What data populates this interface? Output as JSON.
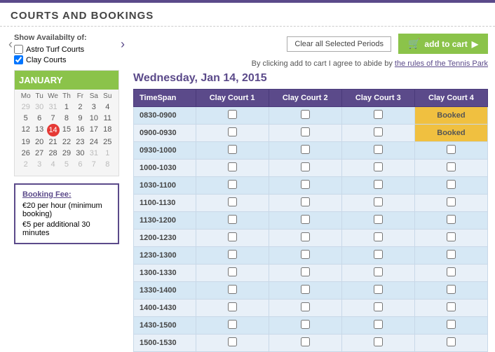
{
  "page": {
    "title": "COURTS AND BOOKINGS",
    "top_bar_color": "#5b4a8a"
  },
  "actions": {
    "clear_btn_label": "Clear all Selected Periods",
    "cart_btn_label": "add to cart",
    "agree_text": "By clicking add to cart I agree to abide by",
    "agree_link": "the rules of the Tennis Park"
  },
  "availability": {
    "label": "Show Availabilty of:",
    "options": [
      {
        "id": "astro",
        "label": "Astro Turf Courts",
        "checked": false
      },
      {
        "id": "clay",
        "label": "Clay Courts",
        "checked": true
      }
    ]
  },
  "calendar": {
    "month": "JANUARY",
    "days_header": [
      "Mo",
      "Tu",
      "We",
      "Th",
      "Fr",
      "Sa",
      "Su"
    ],
    "weeks": [
      [
        "29",
        "30",
        "31",
        "1",
        "2",
        "3",
        "4"
      ],
      [
        "5",
        "6",
        "7",
        "8",
        "9",
        "10",
        "11"
      ],
      [
        "12",
        "13",
        "14",
        "15",
        "16",
        "17",
        "18"
      ],
      [
        "19",
        "20",
        "21",
        "22",
        "23",
        "24",
        "25"
      ],
      [
        "26",
        "27",
        "28",
        "29",
        "30",
        "31",
        "1"
      ],
      [
        "2",
        "3",
        "4",
        "5",
        "6",
        "7",
        "8"
      ]
    ],
    "today_date": "14",
    "other_month_start": [
      "29",
      "30",
      "31"
    ],
    "other_month_end": [
      "1",
      "2",
      "3",
      "4",
      "1",
      "2",
      "3",
      "4",
      "5",
      "6",
      "7",
      "8"
    ]
  },
  "booking_fee": {
    "title": "Booking Fee:",
    "line1": "€20 per hour (minimum booking)",
    "line2": "€5 per additional 30 minutes"
  },
  "booking_date": "Wednesday, Jan 14, 2015",
  "table": {
    "headers": [
      "TimeSpan",
      "Clay Court 1",
      "Clay Court 2",
      "Clay Court 3",
      "Clay Court 4"
    ],
    "rows": [
      {
        "time": "0830-0900",
        "courts": [
          false,
          false,
          false,
          "Booked"
        ]
      },
      {
        "time": "0900-0930",
        "courts": [
          false,
          false,
          false,
          "Booked"
        ]
      },
      {
        "time": "0930-1000",
        "courts": [
          false,
          false,
          false,
          false
        ]
      },
      {
        "time": "1000-1030",
        "courts": [
          false,
          false,
          false,
          false
        ]
      },
      {
        "time": "1030-1100",
        "courts": [
          false,
          false,
          false,
          false
        ]
      },
      {
        "time": "1100-1130",
        "courts": [
          false,
          false,
          false,
          false
        ]
      },
      {
        "time": "1130-1200",
        "courts": [
          false,
          false,
          false,
          false
        ]
      },
      {
        "time": "1200-1230",
        "courts": [
          false,
          false,
          false,
          false
        ]
      },
      {
        "time": "1230-1300",
        "courts": [
          false,
          false,
          false,
          false
        ]
      },
      {
        "time": "1300-1330",
        "courts": [
          false,
          false,
          false,
          false
        ]
      },
      {
        "time": "1330-1400",
        "courts": [
          false,
          false,
          false,
          false
        ]
      },
      {
        "time": "1400-1430",
        "courts": [
          false,
          false,
          false,
          false
        ]
      },
      {
        "time": "1430-1500",
        "courts": [
          false,
          false,
          false,
          false
        ]
      },
      {
        "time": "1500-1530",
        "courts": [
          false,
          false,
          false,
          false
        ]
      }
    ]
  }
}
